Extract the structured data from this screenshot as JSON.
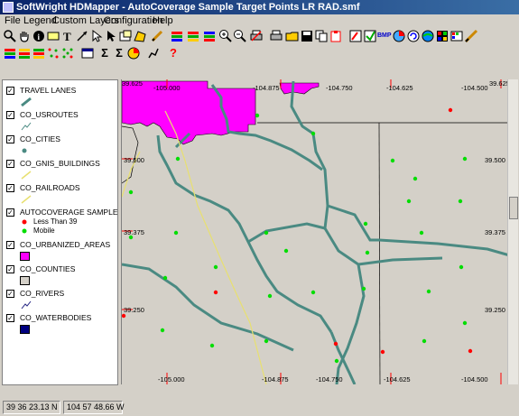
{
  "window": {
    "title": "SoftWright HDMapper - AutoCoverage Sample Target Points LR RAD.smf"
  },
  "menu": [
    {
      "label": "File"
    },
    {
      "label": "Legend"
    },
    {
      "label": "Custom Layers"
    },
    {
      "label": "Configuration"
    },
    {
      "label": "Help"
    }
  ],
  "toolbar": {
    "row1_icons": [
      "zoom-window-icon",
      "pan-hand-icon",
      "info-icon",
      "label-icon",
      "text-icon",
      "line-icon",
      "pointer-icon",
      "select-icon",
      "rectangle-icon",
      "polygon-icon",
      "pencil-icon",
      "layers-icon",
      "layers-edit-icon",
      "layers-add-icon",
      "zoom-in-icon",
      "zoom-out-icon",
      "print-icon",
      "open-folder-icon",
      "save-icon",
      "copy-icon",
      "paste-icon",
      "bmp-export-icon",
      "color-icon",
      "refresh-icon",
      "globe-icon",
      "grid-icon",
      "palette-icon",
      "measure-icon"
    ],
    "bmp_label": "BMP",
    "sigma_label": "Σ",
    "sigma2_label": "Σ",
    "help_label": "?"
  },
  "legend": {
    "layers": [
      {
        "name": "TRAVEL LANES",
        "checked": true,
        "symbol": "line-teal"
      },
      {
        "name": "CO_USROUTES",
        "checked": true,
        "symbol": "line-thin"
      },
      {
        "name": "CO_CITIES",
        "checked": true,
        "symbol": "dot-teal"
      },
      {
        "name": "CO_GNIS_BUILDINGS",
        "checked": true,
        "symbol": "line-yellow"
      },
      {
        "name": "CO_RAILROADS",
        "checked": true,
        "symbol": "line-yellow"
      },
      {
        "name": "AUTOCOVERAGE SAMPLE TAR",
        "checked": true,
        "symbol": "points",
        "items": [
          {
            "label": "Less Than 39",
            "color": "#ff0000"
          },
          {
            "label": "Mobile",
            "color": "#00dd00"
          }
        ]
      },
      {
        "name": "CO_URBANIZED_AREAS",
        "checked": true,
        "symbol": "fill-magenta"
      },
      {
        "name": "CO_COUNTIES",
        "checked": true,
        "symbol": "fill-empty"
      },
      {
        "name": "CO_RIVERS",
        "checked": true,
        "symbol": "line-navy"
      },
      {
        "name": "CO_WATERBODIES",
        "checked": true,
        "symbol": "fill-navy"
      }
    ]
  },
  "map": {
    "top_lon_labels": [
      "-105.000",
      "-104.875",
      "-104.750",
      "-104.625",
      "-104.500"
    ],
    "top_left_lat": "39.625",
    "top_right_lat": "39.625",
    "bottom_lon_labels": [
      "-105.000",
      "-104.875",
      "-104.750",
      "-104.625",
      "-104.500"
    ],
    "left_lat_labels": [
      "39.500",
      "39.375",
      "39.250"
    ],
    "right_lat_labels": [
      "39.500",
      "39.375",
      "39.250"
    ],
    "colors": {
      "road": "#4a8a82",
      "urban": "#ff00ff",
      "less_than_39": "#ff0000",
      "mobile": "#00dd00",
      "background": "#d4d0c8"
    }
  },
  "status": {
    "lat": "39 36 23.13 N",
    "lon": "104 57 48.66 W"
  }
}
